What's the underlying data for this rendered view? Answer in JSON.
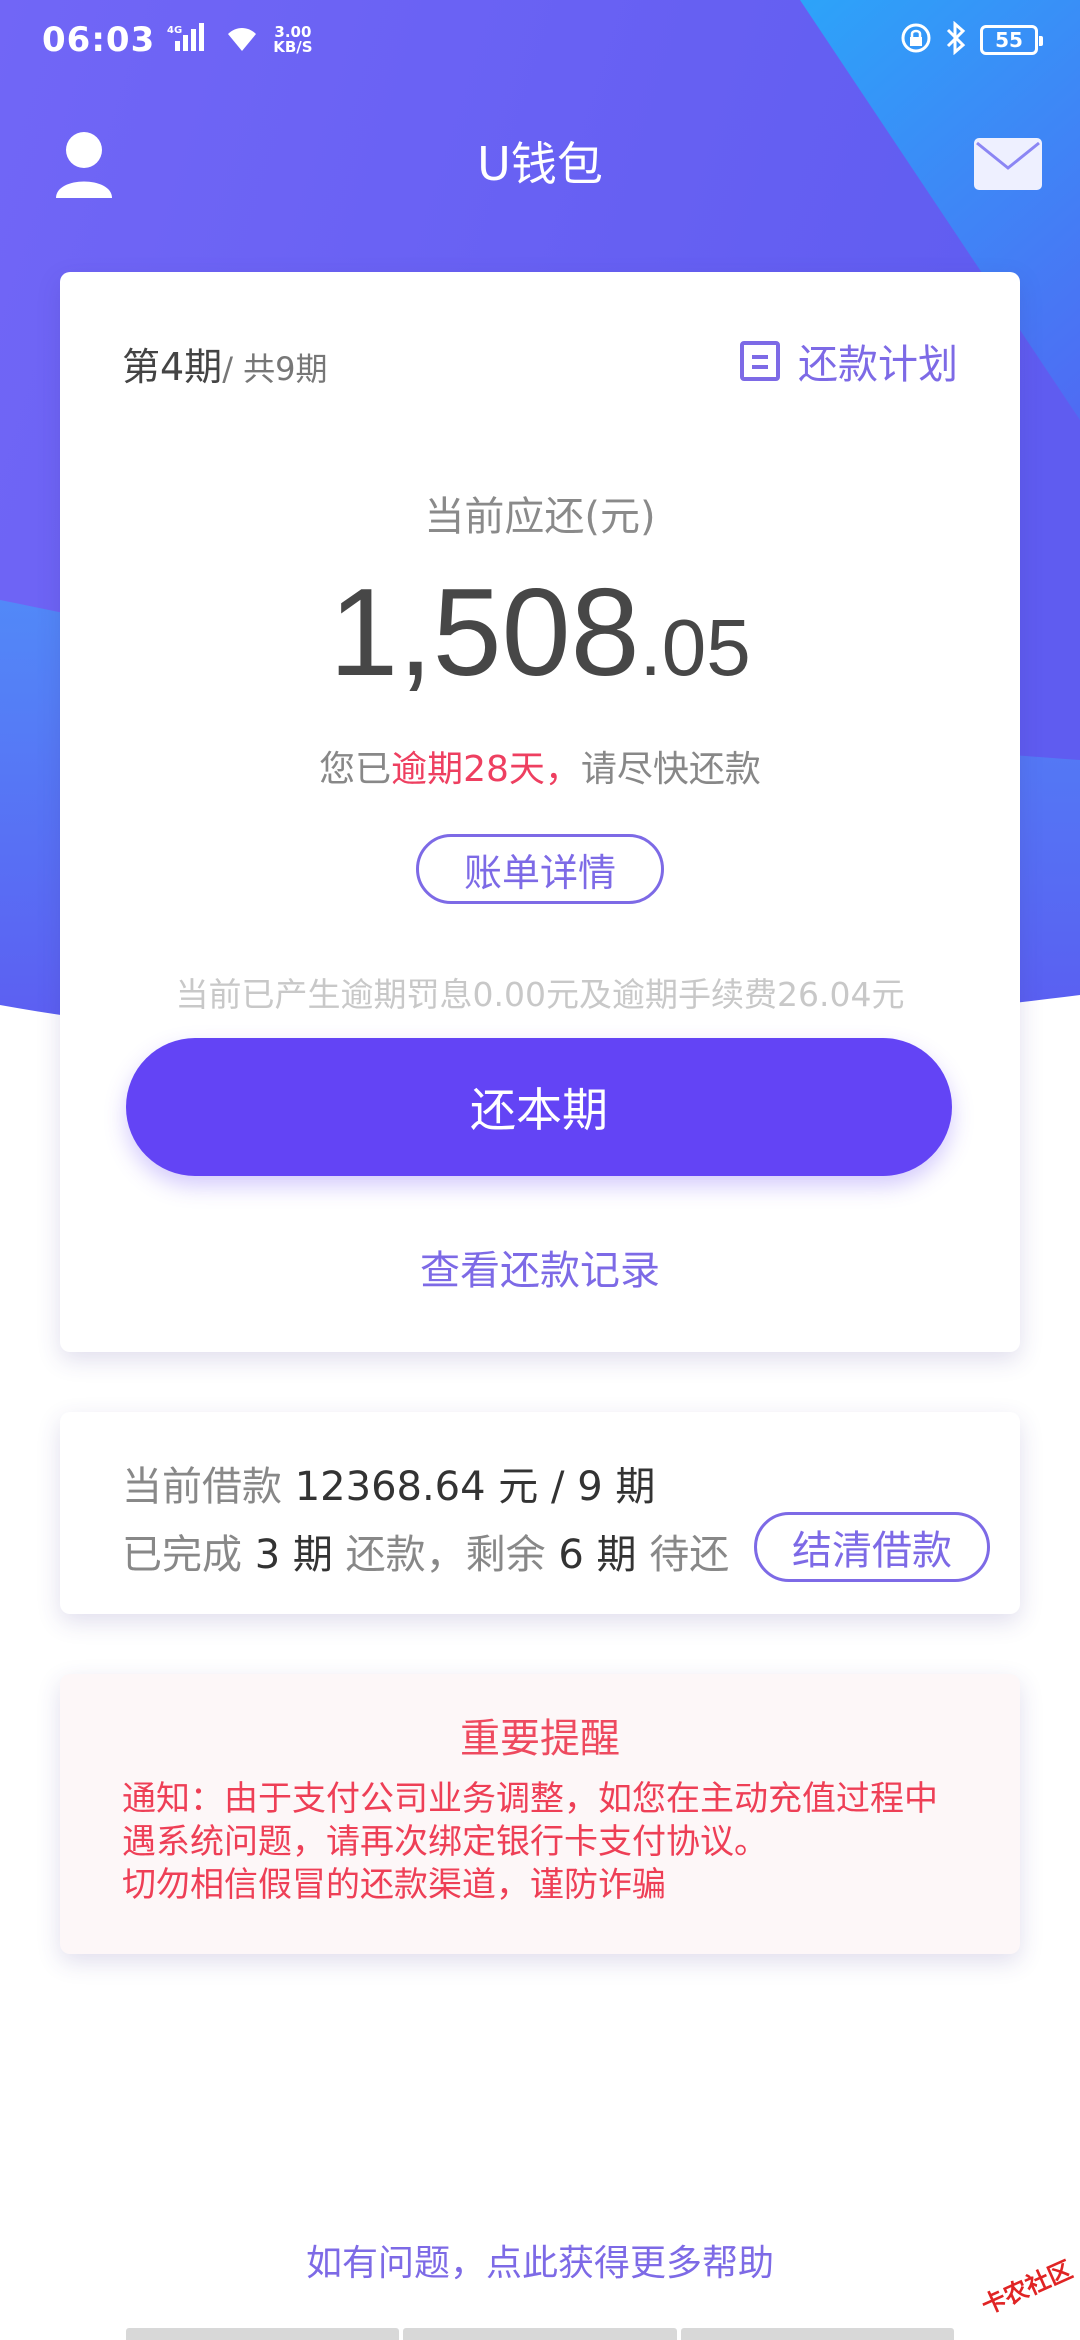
{
  "status_bar": {
    "time": "06:03",
    "network_type": "4G",
    "speed": "3.00",
    "speed_unit": "KB/S",
    "battery": "55"
  },
  "header": {
    "title": "U钱包"
  },
  "repayment": {
    "period_label": "第4期",
    "total_label": "/ 共9期",
    "plan_link": "还款计划",
    "due_label": "当前应还(元)",
    "amount_integer": "1,508",
    "amount_decimal": ".05",
    "overdue_prefix": "您已",
    "overdue_highlight": "逾期28天，",
    "overdue_suffix": "请尽快还款",
    "bill_detail_button": "账单详情",
    "penalty_text": "当前已产生逾期罚息0.00元及逾期手续费26.04元",
    "pay_button": "还本期",
    "records_link": "查看还款记录"
  },
  "loan": {
    "current_loan_label": "当前借款",
    "amount": "12368.64",
    "unit_periods": "元 / 9 期",
    "completed_prefix": "已完成",
    "completed_count": "3 期",
    "middle_text": "还款，剩余",
    "remaining_count": "6 期",
    "remaining_suffix": "待还",
    "settle_button": "结清借款"
  },
  "notice": {
    "title": "重要提醒",
    "line1": "通知：由于支付公司业务调整，如您在主动充值过程中",
    "line2": "遇系统问题，请再次绑定银行卡支付协议。",
    "line3": "切勿相信假冒的还款渠道，谨防诈骗"
  },
  "help_link": "如有问题，点此获得更多帮助",
  "watermark": "卡农社区",
  "colors": {
    "accent": "#6344f5",
    "link": "#7d6ae6",
    "warning": "#ee3f60",
    "header_gradient_start": "#6a5af9",
    "header_gradient_end": "#28a8f6"
  }
}
